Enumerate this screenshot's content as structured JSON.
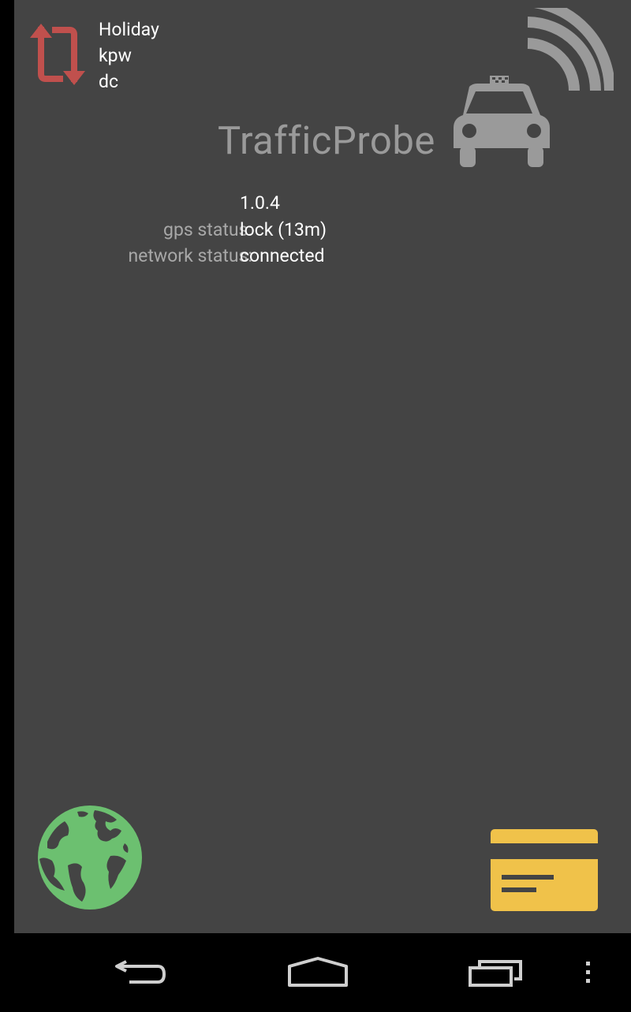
{
  "header": {
    "lines": [
      "Holiday",
      "kpw",
      "dc"
    ]
  },
  "app": {
    "title": "TrafficProbe",
    "version": "1.0.4"
  },
  "status": {
    "gps_label": "gps status:",
    "gps_value": "lock (13m)",
    "network_label": "network status:",
    "network_value": "connected"
  },
  "icons": {
    "sync": "sync-icon",
    "taxi": "taxi-signal-icon",
    "globe": "globe-icon",
    "card": "card-icon",
    "back": "back-icon",
    "home": "home-icon",
    "recents": "recent-apps-icon",
    "menu": "overflow-menu-icon"
  },
  "colors": {
    "background": "#444444",
    "sync_icon": "#c0504d",
    "globe_icon": "#6cc070",
    "card_icon": "#f0c24a",
    "taxi_icon": "#9a9a9a"
  }
}
